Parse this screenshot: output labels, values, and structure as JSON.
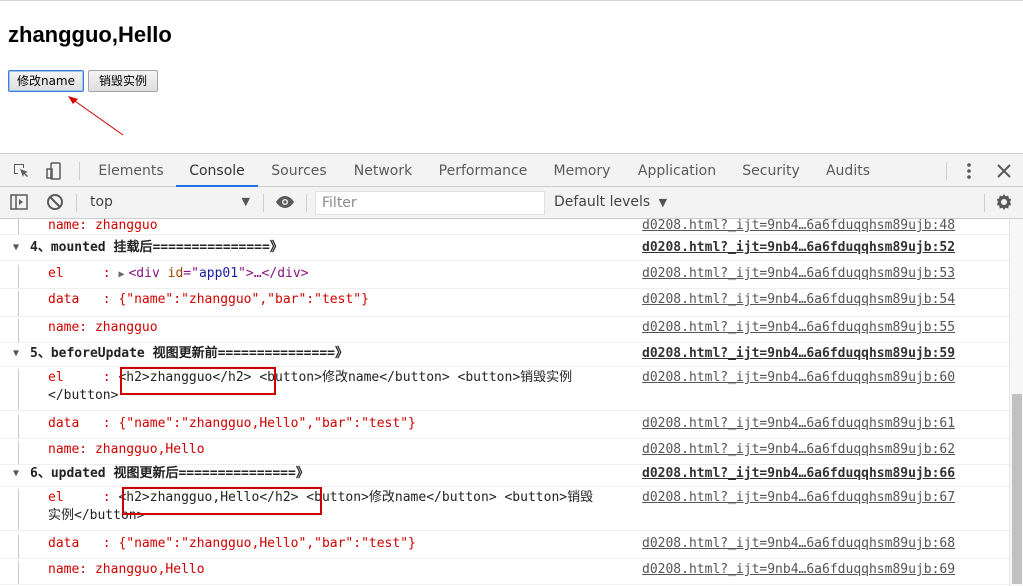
{
  "page": {
    "heading": "zhangguo,Hello",
    "buttons": {
      "rename": "修改name",
      "destroy": "销毁实例"
    }
  },
  "devtools": {
    "tabs": [
      "Elements",
      "Console",
      "Sources",
      "Network",
      "Performance",
      "Memory",
      "Application",
      "Security",
      "Audits"
    ],
    "active_tab": "Console",
    "context": "top",
    "filter_placeholder": "Filter",
    "levels": "Default levels",
    "icons": [
      "inspect-icon",
      "device-icon",
      "sidebar-icon",
      "clear-icon",
      "eye-icon",
      "kebab-icon",
      "close-icon",
      "settings-icon"
    ]
  },
  "console": {
    "rows": [
      {
        "kind": "line",
        "label": "name: ",
        "value": "zhangguo",
        "src": "d0208.html?_ijt=9nb4…6a6fduqqhsm89ujb:48"
      },
      {
        "kind": "group",
        "text": "4、mounted 挂载后===============》",
        "src": "d0208.html?_ijt=9nb4…6a6fduqqhsm89ujb:52"
      },
      {
        "kind": "el-collapsed",
        "label": "el     : ",
        "tag_open": "<div ",
        "attr": "id",
        "eq": "=\"",
        "attr_value": "app01",
        "tag_close": "\">…</div>",
        "src": "d0208.html?_ijt=9nb4…6a6fduqqhsm89ujb:53"
      },
      {
        "kind": "line",
        "label": "data   : ",
        "value": "{\"name\":\"zhangguo\",\"bar\":\"test\"}",
        "src": "d0208.html?_ijt=9nb4…6a6fduqqhsm89ujb:54"
      },
      {
        "kind": "line",
        "label": "name: ",
        "value": "zhangguo",
        "src": "d0208.html?_ijt=9nb4…6a6fduqqhsm89ujb:55"
      },
      {
        "kind": "group",
        "text": "5、beforeUpdate 视图更新前===============》",
        "src": "d0208.html?_ijt=9nb4…6a6fduqqhsm89ujb:59"
      },
      {
        "kind": "el-html",
        "label": "el     : ",
        "h2": "<h2>zhangguo</h2>",
        "rest1": " <button>修改name</button> <button>销毁实例",
        "rest2": "</button>",
        "src": "d0208.html?_ijt=9nb4…6a6fduqqhsm89ujb:60"
      },
      {
        "kind": "line",
        "label": "data   : ",
        "value": "{\"name\":\"zhangguo,Hello\",\"bar\":\"test\"}",
        "src": "d0208.html?_ijt=9nb4…6a6fduqqhsm89ujb:61"
      },
      {
        "kind": "line",
        "label": "name: ",
        "value": "zhangguo,Hello",
        "src": "d0208.html?_ijt=9nb4…6a6fduqqhsm89ujb:62"
      },
      {
        "kind": "group",
        "text": "6、updated 视图更新后===============》",
        "src": "d0208.html?_ijt=9nb4…6a6fduqqhsm89ujb:66"
      },
      {
        "kind": "el-html",
        "label": "el     : ",
        "h2": "<h2>zhangguo,Hello</h2>",
        "rest1": " <button>修改name</button> <button>销毁",
        "rest2": "实例</button>",
        "src": "d0208.html?_ijt=9nb4…6a6fduqqhsm89ujb:67"
      },
      {
        "kind": "line",
        "label": "data   : ",
        "value": "{\"name\":\"zhangguo,Hello\",\"bar\":\"test\"}",
        "src": "d0208.html?_ijt=9nb4…6a6fduqqhsm89ujb:68"
      },
      {
        "kind": "line",
        "label": "name: ",
        "value": "zhangguo,Hello",
        "src": "d0208.html?_ijt=9nb4…6a6fduqqhsm89ujb:69"
      }
    ]
  }
}
